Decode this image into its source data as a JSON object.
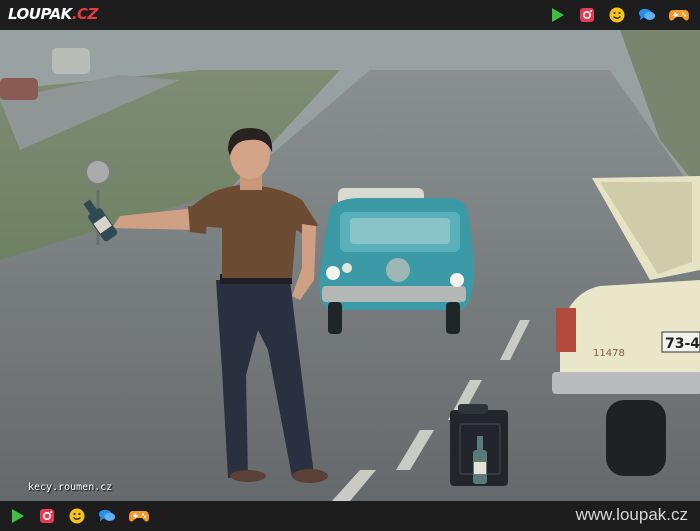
{
  "header": {
    "logo_main": "LOUPAK",
    "logo_tld": ".CZ",
    "icons": [
      "play-icon",
      "instagram-icon",
      "smiley-icon",
      "chat-icon",
      "gamepad-icon"
    ]
  },
  "photo": {
    "watermark": "kecy.roumen.cz",
    "license_plate": "73-4"
  },
  "footer": {
    "site_url": "www.loupak.cz",
    "icons": [
      "play-icon",
      "instagram-icon",
      "smiley-icon",
      "chat-icon",
      "gamepad-icon"
    ]
  },
  "colors": {
    "play": "#3fbf3f",
    "instagram": "#e53a4f",
    "smiley": "#f6c31a",
    "chat": "#2b8fe8",
    "gamepad": "#f39a2b"
  }
}
